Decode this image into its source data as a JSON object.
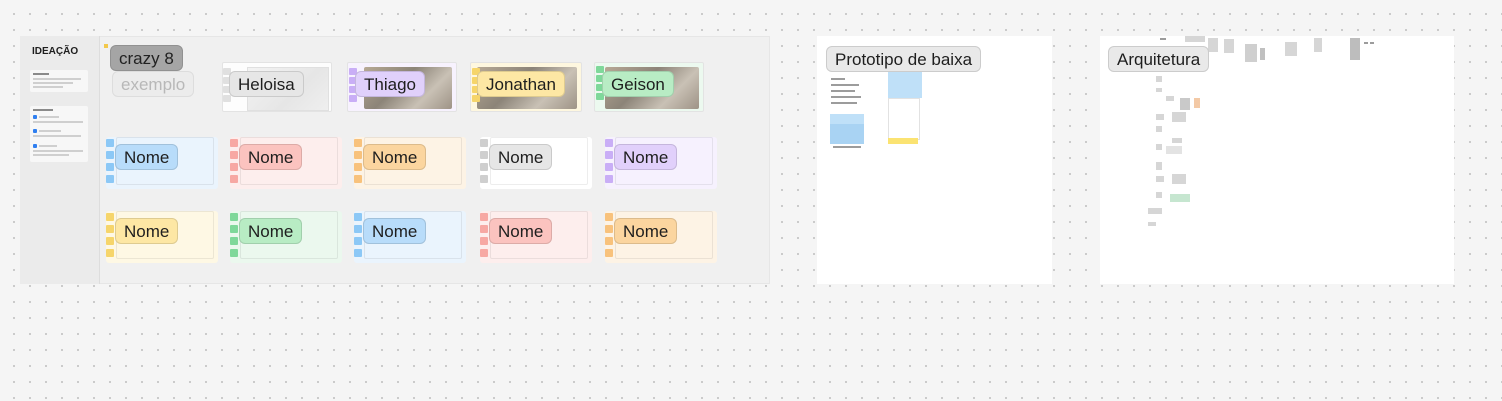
{
  "ideation": {
    "title": "IDEAÇÃO",
    "crazy8_label": "crazy 8",
    "example_label": "exemplo",
    "participants": [
      {
        "name": "Heloisa",
        "color": "#e6e6e6"
      },
      {
        "name": "Thiago",
        "color": "#e0d0fb"
      },
      {
        "name": "Jonathan",
        "color": "#fde7a4"
      },
      {
        "name": "Geison",
        "color": "#b8ecc4"
      }
    ],
    "name_cards": [
      {
        "label": "Nome",
        "color": "#b8dcfa",
        "tint": "#eaf4fd"
      },
      {
        "label": "Nome",
        "color": "#fbc3bf",
        "tint": "#fdeeed"
      },
      {
        "label": "Nome",
        "color": "#fbd59f",
        "tint": "#fdf3e5"
      },
      {
        "label": "Nome",
        "color": "#e6e6e6",
        "tint": "#ffffff"
      },
      {
        "label": "Nome",
        "color": "#e1d0fb",
        "tint": "#f6f1fe"
      },
      {
        "label": "Nome",
        "color": "#fde7a4",
        "tint": "#fef8e4"
      },
      {
        "label": "Nome",
        "color": "#b8ecc4",
        "tint": "#ebf8ee"
      },
      {
        "label": "Nome",
        "color": "#b8dcfa",
        "tint": "#eaf4fd"
      },
      {
        "label": "Nome",
        "color": "#fbc3bf",
        "tint": "#fdeeed"
      },
      {
        "label": "Nome",
        "color": "#fbd59f",
        "tint": "#fdf3e5"
      }
    ]
  },
  "frames": {
    "prototype_label": "Prototipo de baixa",
    "architecture_label": "Arquitetura"
  },
  "colors": {
    "canvas": "#f5f5f5",
    "section": "#f0f0f0",
    "frame": "#ffffff",
    "prototype_blue": "#bfe0f8",
    "prototype_yellow": "#fbe372"
  }
}
